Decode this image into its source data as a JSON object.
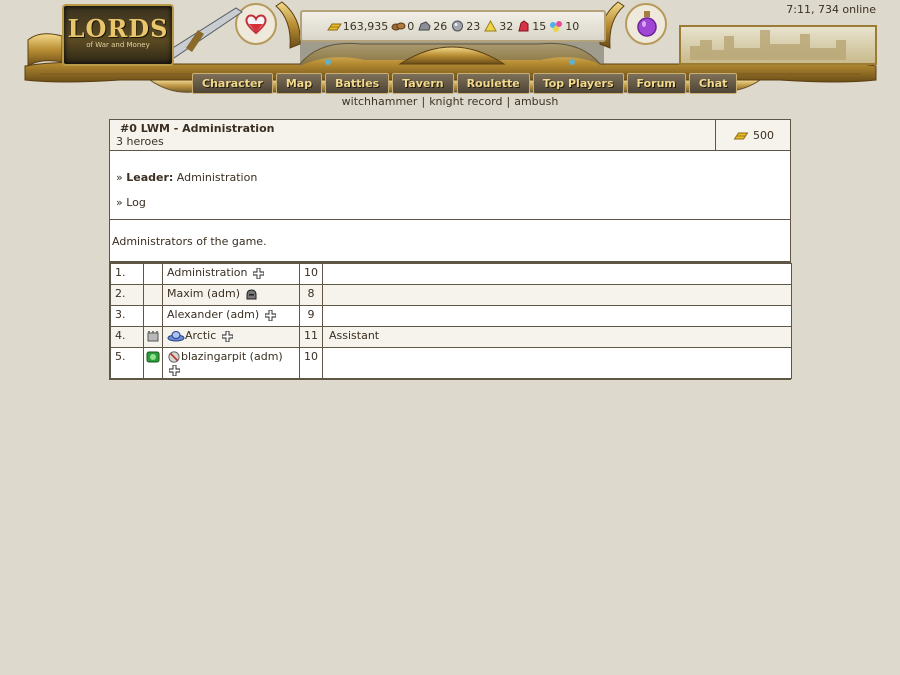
{
  "header": {
    "clock": "7:11, 734 online",
    "logo": {
      "title": "LORDS",
      "subtitle": "of War and Money"
    },
    "resources": [
      {
        "icon": "gold-icon",
        "value": "163,935"
      },
      {
        "icon": "wood-icon",
        "value": "0"
      },
      {
        "icon": "ore-icon",
        "value": "26"
      },
      {
        "icon": "mercury-icon",
        "value": "23"
      },
      {
        "icon": "sulfur-icon",
        "value": "32"
      },
      {
        "icon": "crystal-icon",
        "value": "15"
      },
      {
        "icon": "gems-icon",
        "value": "10"
      }
    ],
    "nav": [
      "Character",
      "Map",
      "Battles",
      "Tavern",
      "Roulette",
      "Top Players",
      "Forum",
      "Chat"
    ],
    "sublinks": [
      "witchhammer",
      "knight record",
      "ambush"
    ]
  },
  "clan": {
    "title": "#0 LWM - Administration",
    "heroes": "3 heroes",
    "gold": "500",
    "leader_label": "Leader:",
    "leader_name": "Administration",
    "log_label": "Log",
    "description": "Administrators of the game.",
    "members": [
      {
        "num": "1.",
        "badge": "",
        "guild_icon": "",
        "name": "Administration",
        "status": "cross",
        "level": "10",
        "role": ""
      },
      {
        "num": "2.",
        "badge": "",
        "guild_icon": "",
        "name": "Maxim (adm)",
        "status": "helmet",
        "level": "8",
        "role": ""
      },
      {
        "num": "3.",
        "badge": "",
        "guild_icon": "",
        "name": "Alexander (adm)",
        "status": "cross",
        "level": "9",
        "role": ""
      },
      {
        "num": "4.",
        "badge": "tower",
        "guild_icon": "ufo",
        "name": "Arctic",
        "status": "cross",
        "level": "11",
        "role": "Assistant"
      },
      {
        "num": "5.",
        "badge": "green",
        "guild_icon": "ball",
        "name": "blazingarpit (adm)",
        "status": "cross",
        "level": "10",
        "role": ""
      }
    ]
  },
  "colors": {
    "background": "#ddd9cd",
    "border": "#5f5646",
    "nav_text": "#f1d98d"
  }
}
